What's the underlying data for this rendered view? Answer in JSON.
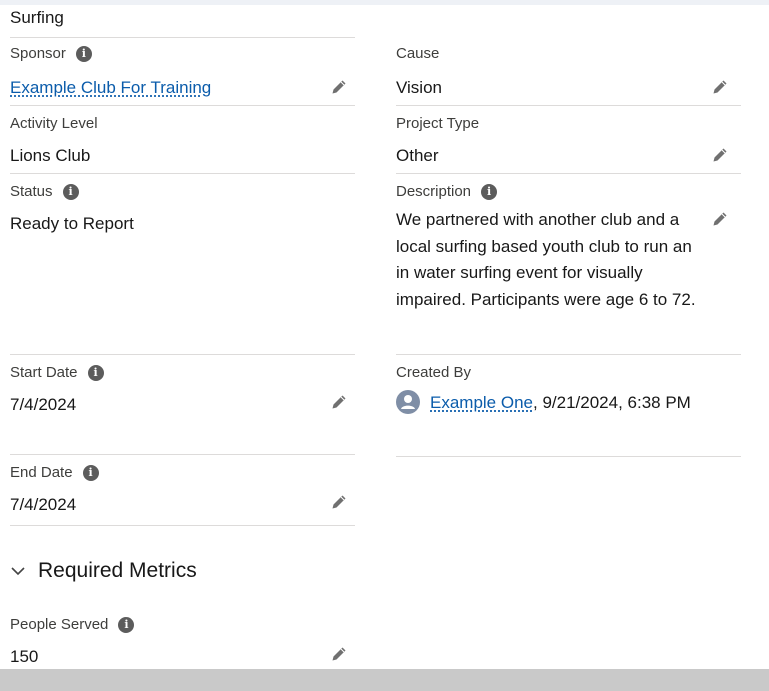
{
  "record": {
    "name": "Surfing"
  },
  "fields": {
    "sponsor": {
      "label": "Sponsor",
      "value": "Example Club For Training"
    },
    "cause": {
      "label": "Cause",
      "value": "Vision"
    },
    "activity_level": {
      "label": "Activity Level",
      "value": "Lions Club"
    },
    "project_type": {
      "label": "Project Type",
      "value": "Other"
    },
    "status": {
      "label": "Status",
      "value": "Ready to Report"
    },
    "description": {
      "label": "Description",
      "value": "We partnered with another club and a local surfing based youth club to run an in water surfing event for visually impaired. Participants were age 6 to 72."
    },
    "start_date": {
      "label": "Start Date",
      "value": "7/4/2024"
    },
    "created_by": {
      "label": "Created By",
      "user": "Example One",
      "timestamp": ", 9/21/2024, 6:38 PM"
    },
    "end_date": {
      "label": "End Date",
      "value": "7/4/2024"
    },
    "people_served": {
      "label": "People Served",
      "value": "150"
    }
  },
  "sections": {
    "required_metrics": {
      "title": "Required Metrics"
    }
  },
  "icons": {
    "info": "info-icon",
    "edit": "pencil-icon",
    "avatar": "user-avatar-icon",
    "chevron": "chevron-down-icon"
  },
  "colors": {
    "link": "#0b5cab",
    "label": "#3e3e3c",
    "divider": "#dddbda",
    "icon": "#5c5c5c"
  }
}
